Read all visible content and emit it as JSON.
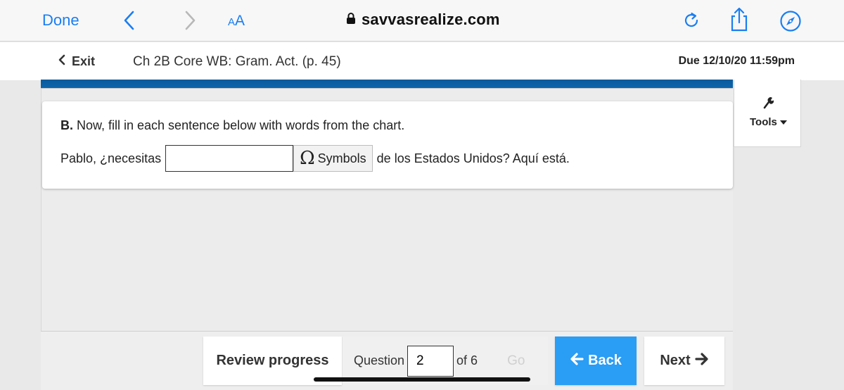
{
  "browser": {
    "done_label": "Done",
    "aa_small": "A",
    "aa_big": "A",
    "url": "savvasrealize.com",
    "icons": [
      "back-chevron-icon",
      "forward-chevron-icon",
      "lock-icon",
      "reload-icon",
      "share-icon",
      "compass-icon"
    ]
  },
  "header": {
    "exit_label": "Exit",
    "title": "Ch 2B Core WB: Gram. Act. (p. 45)",
    "due": "Due 12/10/20 11:59pm"
  },
  "question": {
    "instruction_letter": "B.",
    "instruction_text": " Now, fill in each sentence below with words from the chart.",
    "sentence_before": "Pablo, ¿necesitas",
    "answer_value": "",
    "symbols_glyph": "Ω",
    "symbols_label": "Symbols",
    "sentence_after": "de los Estados Unidos? Aquí está."
  },
  "tools": {
    "label": "Tools"
  },
  "footer": {
    "review_label": "Review progress",
    "question_label": "Question",
    "current_question": "2",
    "of_label": "of 6",
    "go_label": "Go",
    "back_label": "Back",
    "next_label": "Next"
  },
  "colors": {
    "ios_blue": "#1a7ef2",
    "strip_blue": "#0d64ab",
    "back_button": "#2a9df4"
  }
}
